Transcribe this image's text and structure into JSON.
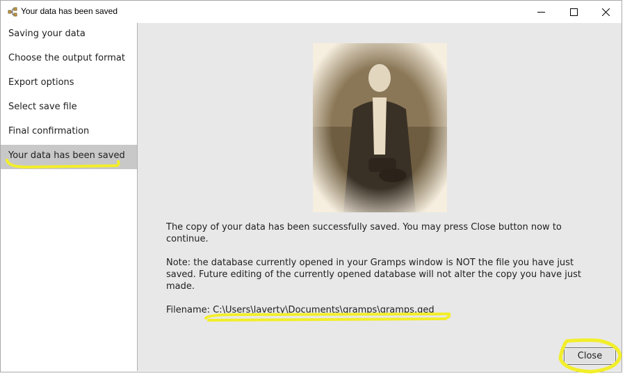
{
  "window": {
    "title": "Your data has been saved"
  },
  "sidebar": {
    "items": [
      {
        "label": "Saving your data"
      },
      {
        "label": "Choose the output format"
      },
      {
        "label": "Export options"
      },
      {
        "label": "Select save file"
      },
      {
        "label": "Final confirmation"
      },
      {
        "label": "Your data has been saved"
      }
    ],
    "active_index": 5
  },
  "main": {
    "message": "The copy of your data has been successfully saved. You may press Close button now to continue.",
    "note": "Note: the database currently opened in your Gramps window is NOT the file you have just saved. Future editing of the currently opened database will not alter the copy you have just made.",
    "filename_label": "Filename:",
    "filename_value": "C:\\Users\\laverty\\Documents\\gramps\\gramps.ged"
  },
  "buttons": {
    "close_label": "Close"
  },
  "colors": {
    "highlight": "#f2ee2a",
    "active_item": "#c8c8c8",
    "content_bg": "#e8e8e8"
  }
}
